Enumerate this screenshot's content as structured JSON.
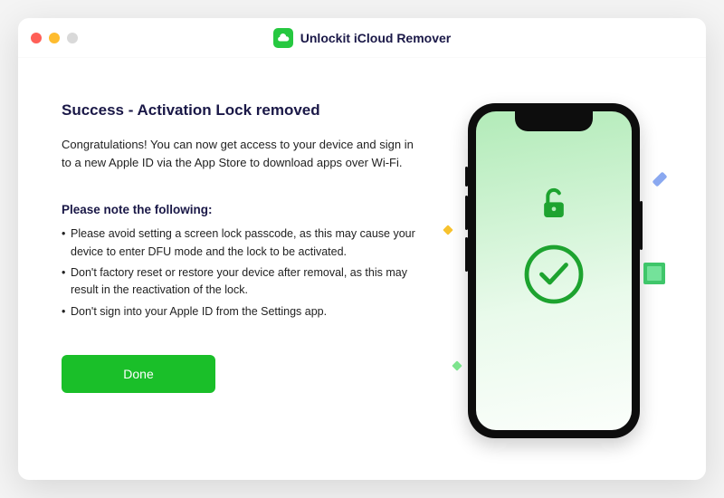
{
  "app": {
    "title": "Unlockit iCloud Remover"
  },
  "main": {
    "heading": "Success - Activation Lock removed",
    "subtext": "Congratulations! You can now get access to your device and sign in to a new Apple ID via the App Store to download apps over Wi-Fi.",
    "note_heading": "Please note the following:",
    "bullets": [
      "Please avoid setting a screen lock passcode, as this may cause your device to enter DFU mode and the lock to be activated.",
      "Don't factory reset or restore your device after removal, as this may result in the reactivation of the lock.",
      "Don't sign into your Apple ID from the Settings app."
    ],
    "done_label": "Done"
  },
  "colors": {
    "accent_green": "#1abf29",
    "heading_navy": "#1a1847"
  }
}
